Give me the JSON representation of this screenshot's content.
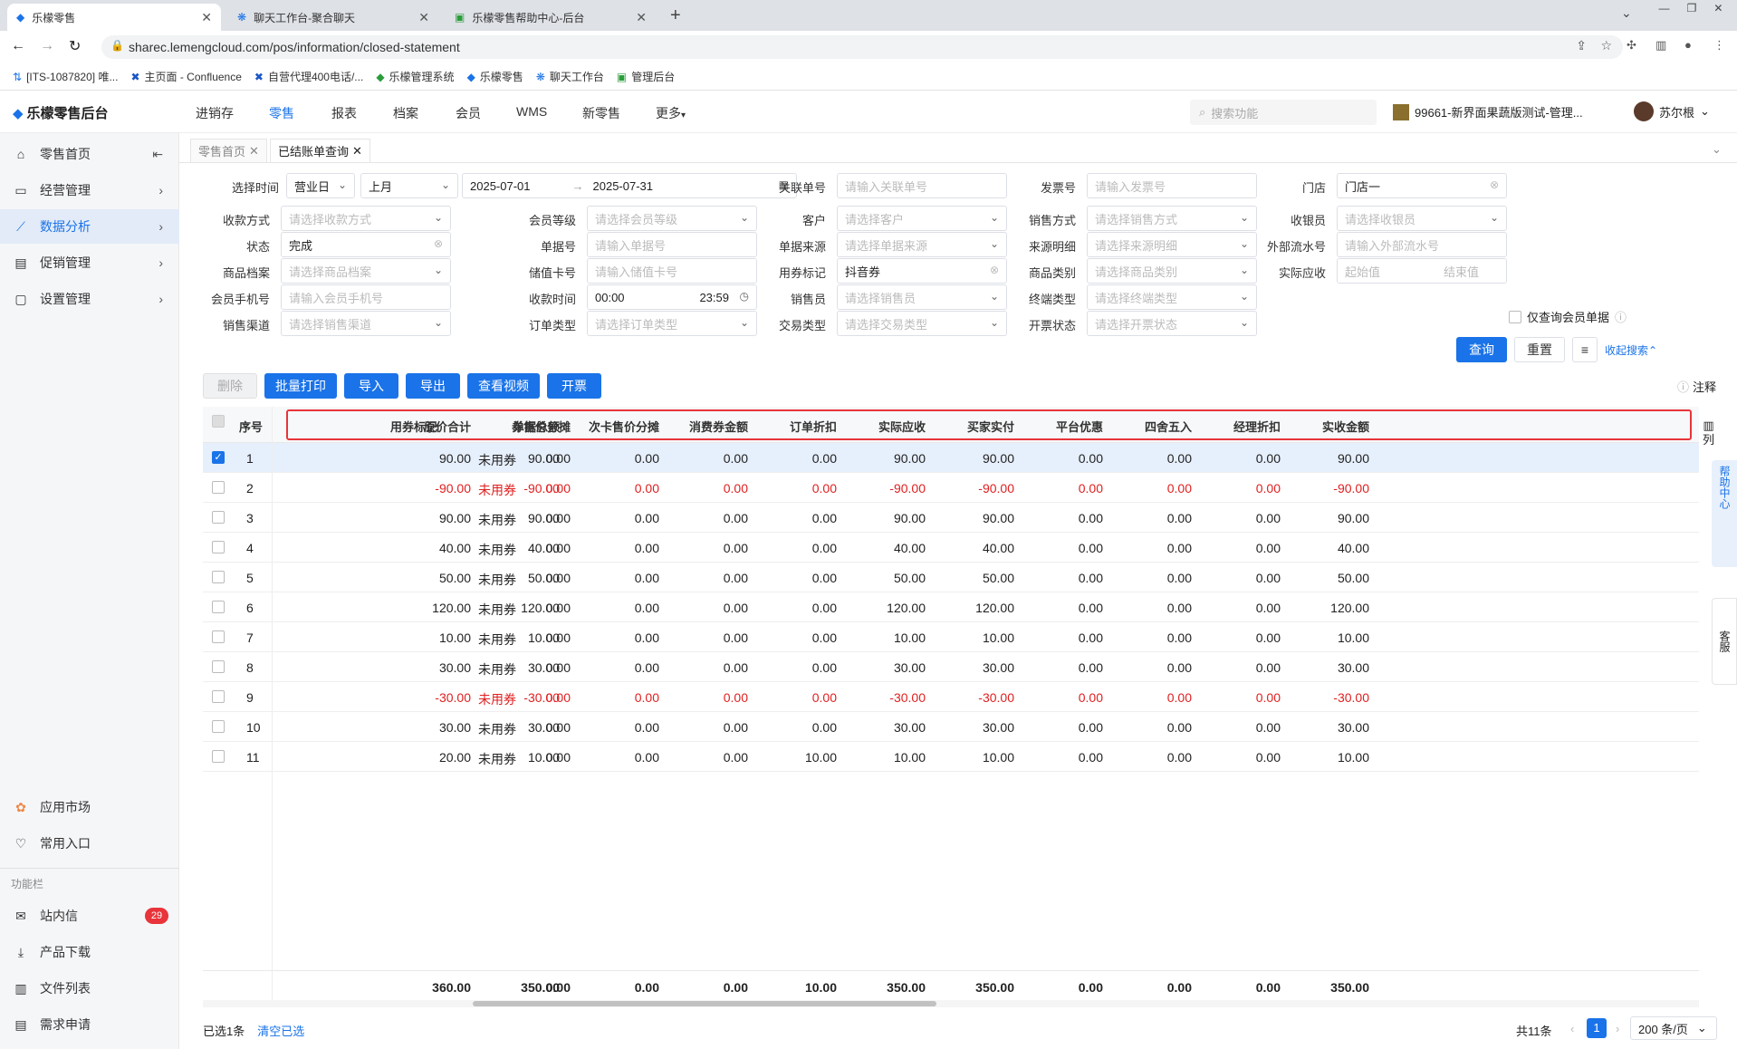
{
  "browser": {
    "tabs": [
      {
        "title": "乐檬零售",
        "active": true
      },
      {
        "title": "聊天工作台-聚合聊天",
        "active": false
      },
      {
        "title": "乐檬零售帮助中心-后台",
        "active": false
      }
    ],
    "url": "sharec.lemengcloud.com/pos/information/closed-statement",
    "bookmarks": [
      "[ITS-1087820] 唯...",
      "主页面 - Confluence",
      "自营代理400电话/...",
      "乐檬管理系统",
      "乐檬零售",
      "聊天工作台",
      "管理后台"
    ]
  },
  "app": {
    "logo": "乐檬零售后台",
    "nav": [
      "进销存",
      "零售",
      "报表",
      "档案",
      "会员",
      "WMS",
      "新零售",
      "更多"
    ],
    "active_nav": "零售",
    "search_placeholder": "搜索功能",
    "store": "99661-新界面果蔬版测试-管理...",
    "user": "苏尔根"
  },
  "sidebar": {
    "items": [
      "零售首页",
      "经营管理",
      "数据分析",
      "促销管理",
      "设置管理"
    ],
    "active": "数据分析",
    "bottom": [
      "应用市场",
      "常用入口"
    ],
    "section": "功能栏",
    "func": [
      "站内信",
      "产品下载",
      "文件列表",
      "需求申请"
    ],
    "badge": "29"
  },
  "pagetabs": [
    "零售首页",
    "已结账单查询"
  ],
  "filters": {
    "select_time_label": "选择时间",
    "time_type": "营业日",
    "period": "上月",
    "start_date": "2025-07-01",
    "end_date": "2025-07-31",
    "rows": [
      [
        {
          "l": "关联单号",
          "p": "请输入关联单号"
        },
        {
          "l": "发票号",
          "p": "请输入发票号"
        },
        {
          "l": "门店",
          "v": "门店一"
        }
      ],
      [
        {
          "l": "收款方式",
          "p": "请选择收款方式"
        },
        {
          "l": "会员等级",
          "p": "请选择会员等级"
        },
        {
          "l": "客户",
          "p": "请选择客户"
        },
        {
          "l": "销售方式",
          "p": "请选择销售方式"
        },
        {
          "l": "收银员",
          "p": "请选择收银员"
        }
      ],
      [
        {
          "l": "状态",
          "v": "完成"
        },
        {
          "l": "单据号",
          "p": "请输入单据号"
        },
        {
          "l": "单据来源",
          "p": "请选择单据来源"
        },
        {
          "l": "来源明细",
          "p": "请选择来源明细"
        },
        {
          "l": "外部流水号",
          "p": "请输入外部流水号"
        }
      ],
      [
        {
          "l": "商品档案",
          "p": "请选择商品档案"
        },
        {
          "l": "储值卡号",
          "p": "请输入储值卡号"
        },
        {
          "l": "用券标记",
          "v": "抖音券"
        },
        {
          "l": "商品类别",
          "p": "请选择商品类别"
        },
        {
          "l": "实际应收",
          "p": "起始值",
          "p2": "结束值"
        }
      ],
      [
        {
          "l": "会员手机号",
          "p": "请输入会员手机号"
        },
        {
          "l": "收款时间",
          "v": "00:00",
          "v2": "23:59"
        },
        {
          "l": "销售员",
          "p": "请选择销售员"
        },
        {
          "l": "终端类型",
          "p": "请选择终端类型"
        }
      ],
      [
        {
          "l": "销售渠道",
          "p": "请选择销售渠道"
        },
        {
          "l": "订单类型",
          "p": "请选择订单类型"
        },
        {
          "l": "交易类型",
          "p": "请选择交易类型"
        },
        {
          "l": "开票状态",
          "p": "请选择开票状态"
        }
      ]
    ],
    "member_only": "仅查询会员单据",
    "query": "查询",
    "reset": "重置",
    "collapse": "收起搜索"
  },
  "actions": [
    "删除",
    "批量打印",
    "导入",
    "导出",
    "查看视频",
    "开票"
  ],
  "note": "注释",
  "columns": [
    "序号",
    "原价合计",
    "单据总额",
    "用券标记",
    "券售价分摊",
    "次卡售价分摊",
    "消费券金额",
    "订单折扣",
    "实际应收",
    "买家实付",
    "平台优惠",
    "四舍五入",
    "经理折扣",
    "实收金额"
  ],
  "col_setting": "列",
  "rows": [
    {
      "no": "1",
      "v": [
        "90.00",
        "90.00",
        "未用券",
        "0.00",
        "0.00",
        "0.00",
        "0.00",
        "90.00",
        "90.00",
        "0.00",
        "0.00",
        "0.00",
        "90.00"
      ],
      "neg": false,
      "sel": true
    },
    {
      "no": "2",
      "v": [
        "-90.00",
        "-90.00",
        "未用券",
        "0.00",
        "0.00",
        "0.00",
        "0.00",
        "-90.00",
        "-90.00",
        "0.00",
        "0.00",
        "0.00",
        "-90.00"
      ],
      "neg": true,
      "sel": false
    },
    {
      "no": "3",
      "v": [
        "90.00",
        "90.00",
        "未用券",
        "0.00",
        "0.00",
        "0.00",
        "0.00",
        "90.00",
        "90.00",
        "0.00",
        "0.00",
        "0.00",
        "90.00"
      ],
      "neg": false,
      "sel": false
    },
    {
      "no": "4",
      "v": [
        "40.00",
        "40.00",
        "未用券",
        "0.00",
        "0.00",
        "0.00",
        "0.00",
        "40.00",
        "40.00",
        "0.00",
        "0.00",
        "0.00",
        "40.00"
      ],
      "neg": false,
      "sel": false
    },
    {
      "no": "5",
      "v": [
        "50.00",
        "50.00",
        "未用券",
        "0.00",
        "0.00",
        "0.00",
        "0.00",
        "50.00",
        "50.00",
        "0.00",
        "0.00",
        "0.00",
        "50.00"
      ],
      "neg": false,
      "sel": false
    },
    {
      "no": "6",
      "v": [
        "120.00",
        "120.00",
        "未用券",
        "0.00",
        "0.00",
        "0.00",
        "0.00",
        "120.00",
        "120.00",
        "0.00",
        "0.00",
        "0.00",
        "120.00"
      ],
      "neg": false,
      "sel": false
    },
    {
      "no": "7",
      "v": [
        "10.00",
        "10.00",
        "未用券",
        "0.00",
        "0.00",
        "0.00",
        "0.00",
        "10.00",
        "10.00",
        "0.00",
        "0.00",
        "0.00",
        "10.00"
      ],
      "neg": false,
      "sel": false
    },
    {
      "no": "8",
      "v": [
        "30.00",
        "30.00",
        "未用券",
        "0.00",
        "0.00",
        "0.00",
        "0.00",
        "30.00",
        "30.00",
        "0.00",
        "0.00",
        "0.00",
        "30.00"
      ],
      "neg": false,
      "sel": false
    },
    {
      "no": "9",
      "v": [
        "-30.00",
        "-30.00",
        "未用券",
        "0.00",
        "0.00",
        "0.00",
        "0.00",
        "-30.00",
        "-30.00",
        "0.00",
        "0.00",
        "0.00",
        "-30.00"
      ],
      "neg": true,
      "sel": false
    },
    {
      "no": "10",
      "v": [
        "30.00",
        "30.00",
        "未用券",
        "0.00",
        "0.00",
        "0.00",
        "0.00",
        "30.00",
        "30.00",
        "0.00",
        "0.00",
        "0.00",
        "30.00"
      ],
      "neg": false,
      "sel": false
    },
    {
      "no": "11",
      "v": [
        "20.00",
        "10.00",
        "未用券",
        "0.00",
        "0.00",
        "0.00",
        "10.00",
        "10.00",
        "10.00",
        "0.00",
        "0.00",
        "0.00",
        "10.00"
      ],
      "neg": false,
      "sel": false
    }
  ],
  "totals": [
    "360.00",
    "350.00",
    "",
    "0.00",
    "0.00",
    "0.00",
    "10.00",
    "350.00",
    "350.00",
    "0.00",
    "0.00",
    "0.00",
    "350.00"
  ],
  "footer": {
    "selected": "已选1条",
    "clear": "清空已选",
    "total": "共11条",
    "page": "1",
    "pagesize": "200 条/页"
  },
  "right_float": {
    "help": "帮助中心",
    "service": "客服"
  },
  "colors": {
    "accent": "#1a73e8",
    "negative": "#e02020",
    "highlight_box": "#e8343a"
  }
}
